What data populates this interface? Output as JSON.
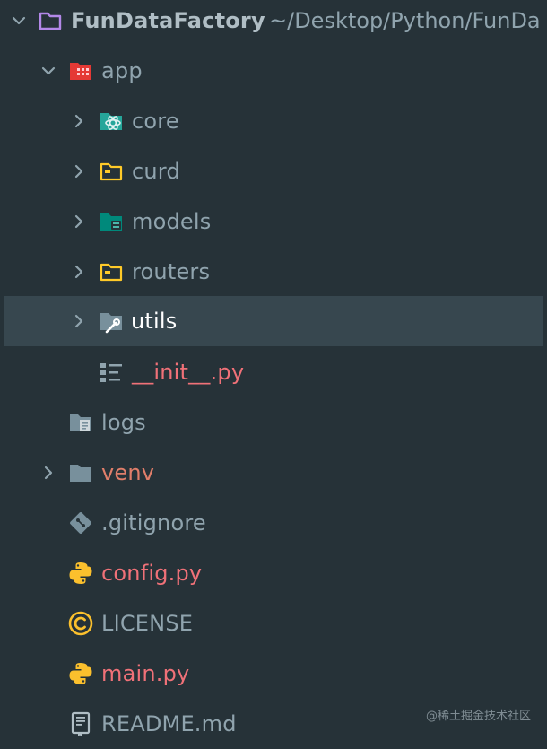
{
  "project": {
    "name": "FunDataFactory",
    "path": "~/Desktop/Python/FunDa"
  },
  "tree": {
    "app": "app",
    "core": "core",
    "curd": "curd",
    "models": "models",
    "routers": "routers",
    "utils": "utils",
    "init": "__init__.py",
    "logs": "logs",
    "venv": "venv",
    "gitignore": ".gitignore",
    "config": "config.py",
    "license": "LICENSE",
    "main": "main.py",
    "readme": "README.md"
  },
  "watermark": "@稀土掘金技术社区",
  "colors": {
    "background": "#263238",
    "selected_row": "#37474f",
    "text_default": "#90a4ae",
    "text_modified": "#f07178",
    "text_selected": "#ffffff",
    "text_excluded": "#e07e6a"
  }
}
